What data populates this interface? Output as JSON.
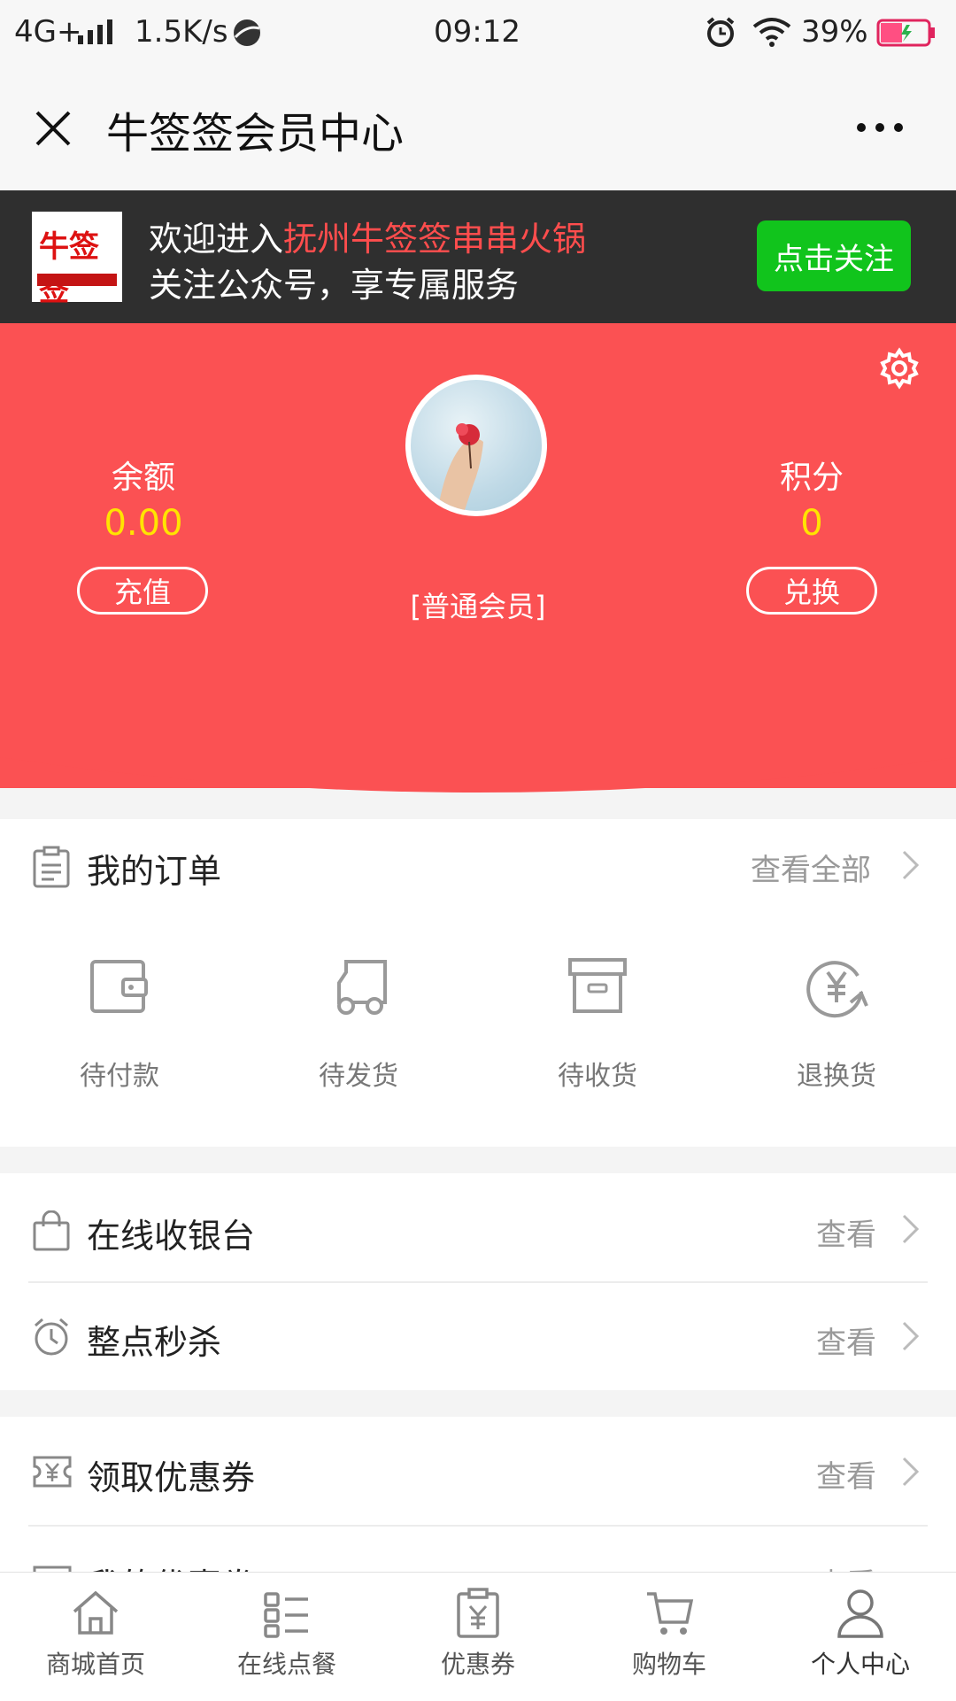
{
  "status_bar": {
    "network": "4G+",
    "speed": "1.5K/s",
    "time": "09:12",
    "battery": "39%"
  },
  "titlebar": {
    "title": "牛签签会员中心",
    "close_icon": "close-icon",
    "more_icon": "more-icon"
  },
  "banner": {
    "logo_text": "牛签签",
    "welcome_prefix": "欢迎进入",
    "brand_name": "抚州牛签签串串火锅",
    "subtitle": "关注公众号，享专属服务",
    "follow_button": "点击关注",
    "follow_color": "#11c41c"
  },
  "profile": {
    "balance_label": "余额",
    "balance_value": "0.00",
    "recharge_button": "充值",
    "points_label": "积分",
    "points_value": "0",
    "exchange_button": "兑换",
    "member_level": "[普通会员]",
    "accent_color": "#fb5153"
  },
  "orders": {
    "title": "我的订单",
    "view_all": "查看全部",
    "items": [
      {
        "label": "待付款",
        "icon": "wallet-icon"
      },
      {
        "label": "待发货",
        "icon": "truck-icon"
      },
      {
        "label": "待收货",
        "icon": "box-icon"
      },
      {
        "label": "退换货",
        "icon": "refund-icon"
      }
    ]
  },
  "services": [
    {
      "title": "在线收银台",
      "link": "查看",
      "icon": "shopping-bag-icon"
    },
    {
      "title": "整点秒杀",
      "link": "查看",
      "icon": "alarm-clock-icon"
    },
    {
      "title": "领取优惠券",
      "link": "查看",
      "icon": "coupon-icon"
    },
    {
      "title": "我的优惠券",
      "link": "查看",
      "icon": "my-coupon-icon"
    }
  ],
  "bottom_nav": [
    {
      "label": "商城首页",
      "icon": "home-icon"
    },
    {
      "label": "在线点餐",
      "icon": "menu-list-icon"
    },
    {
      "label": "优惠券",
      "icon": "voucher-icon"
    },
    {
      "label": "购物车",
      "icon": "cart-icon"
    },
    {
      "label": "个人中心",
      "icon": "user-icon"
    }
  ]
}
